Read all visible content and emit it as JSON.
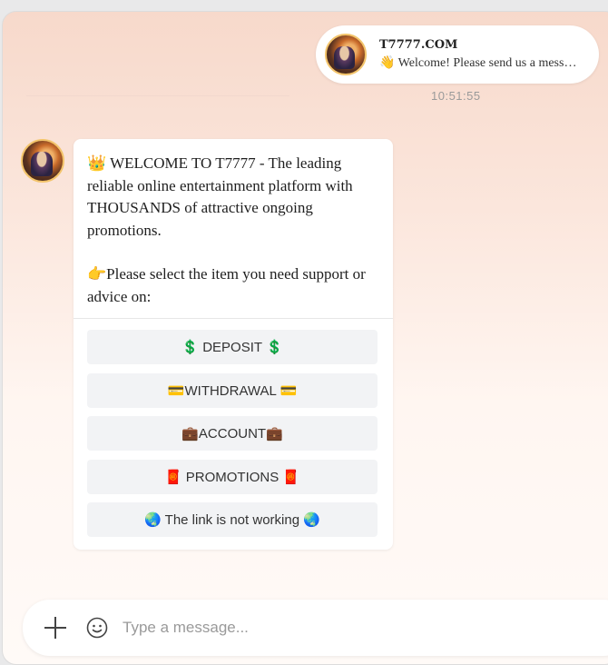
{
  "header": {
    "title": "T7777.COM",
    "preview": "👋 Welcome! Please send us a mess…"
  },
  "timestamp": "10:51:55",
  "message": {
    "paragraph1": "👑 WELCOME TO T7777 - The leading reliable online entertainment platform with THOUSANDS of attractive ongoing promotions.",
    "paragraph2": "👉Please select the item you need support or advice on:"
  },
  "options": [
    {
      "label": "💲 DEPOSIT 💲"
    },
    {
      "label": "💳WITHDRAWAL 💳"
    },
    {
      "label": "💼ACCOUNT💼"
    },
    {
      "label": "🧧 PROMOTIONS 🧧"
    },
    {
      "label": "🌏 The link is not working 🌏"
    }
  ],
  "composer": {
    "placeholder": "Type a message..."
  },
  "icons": {
    "add": "plus-icon",
    "emoji": "smile-icon"
  }
}
